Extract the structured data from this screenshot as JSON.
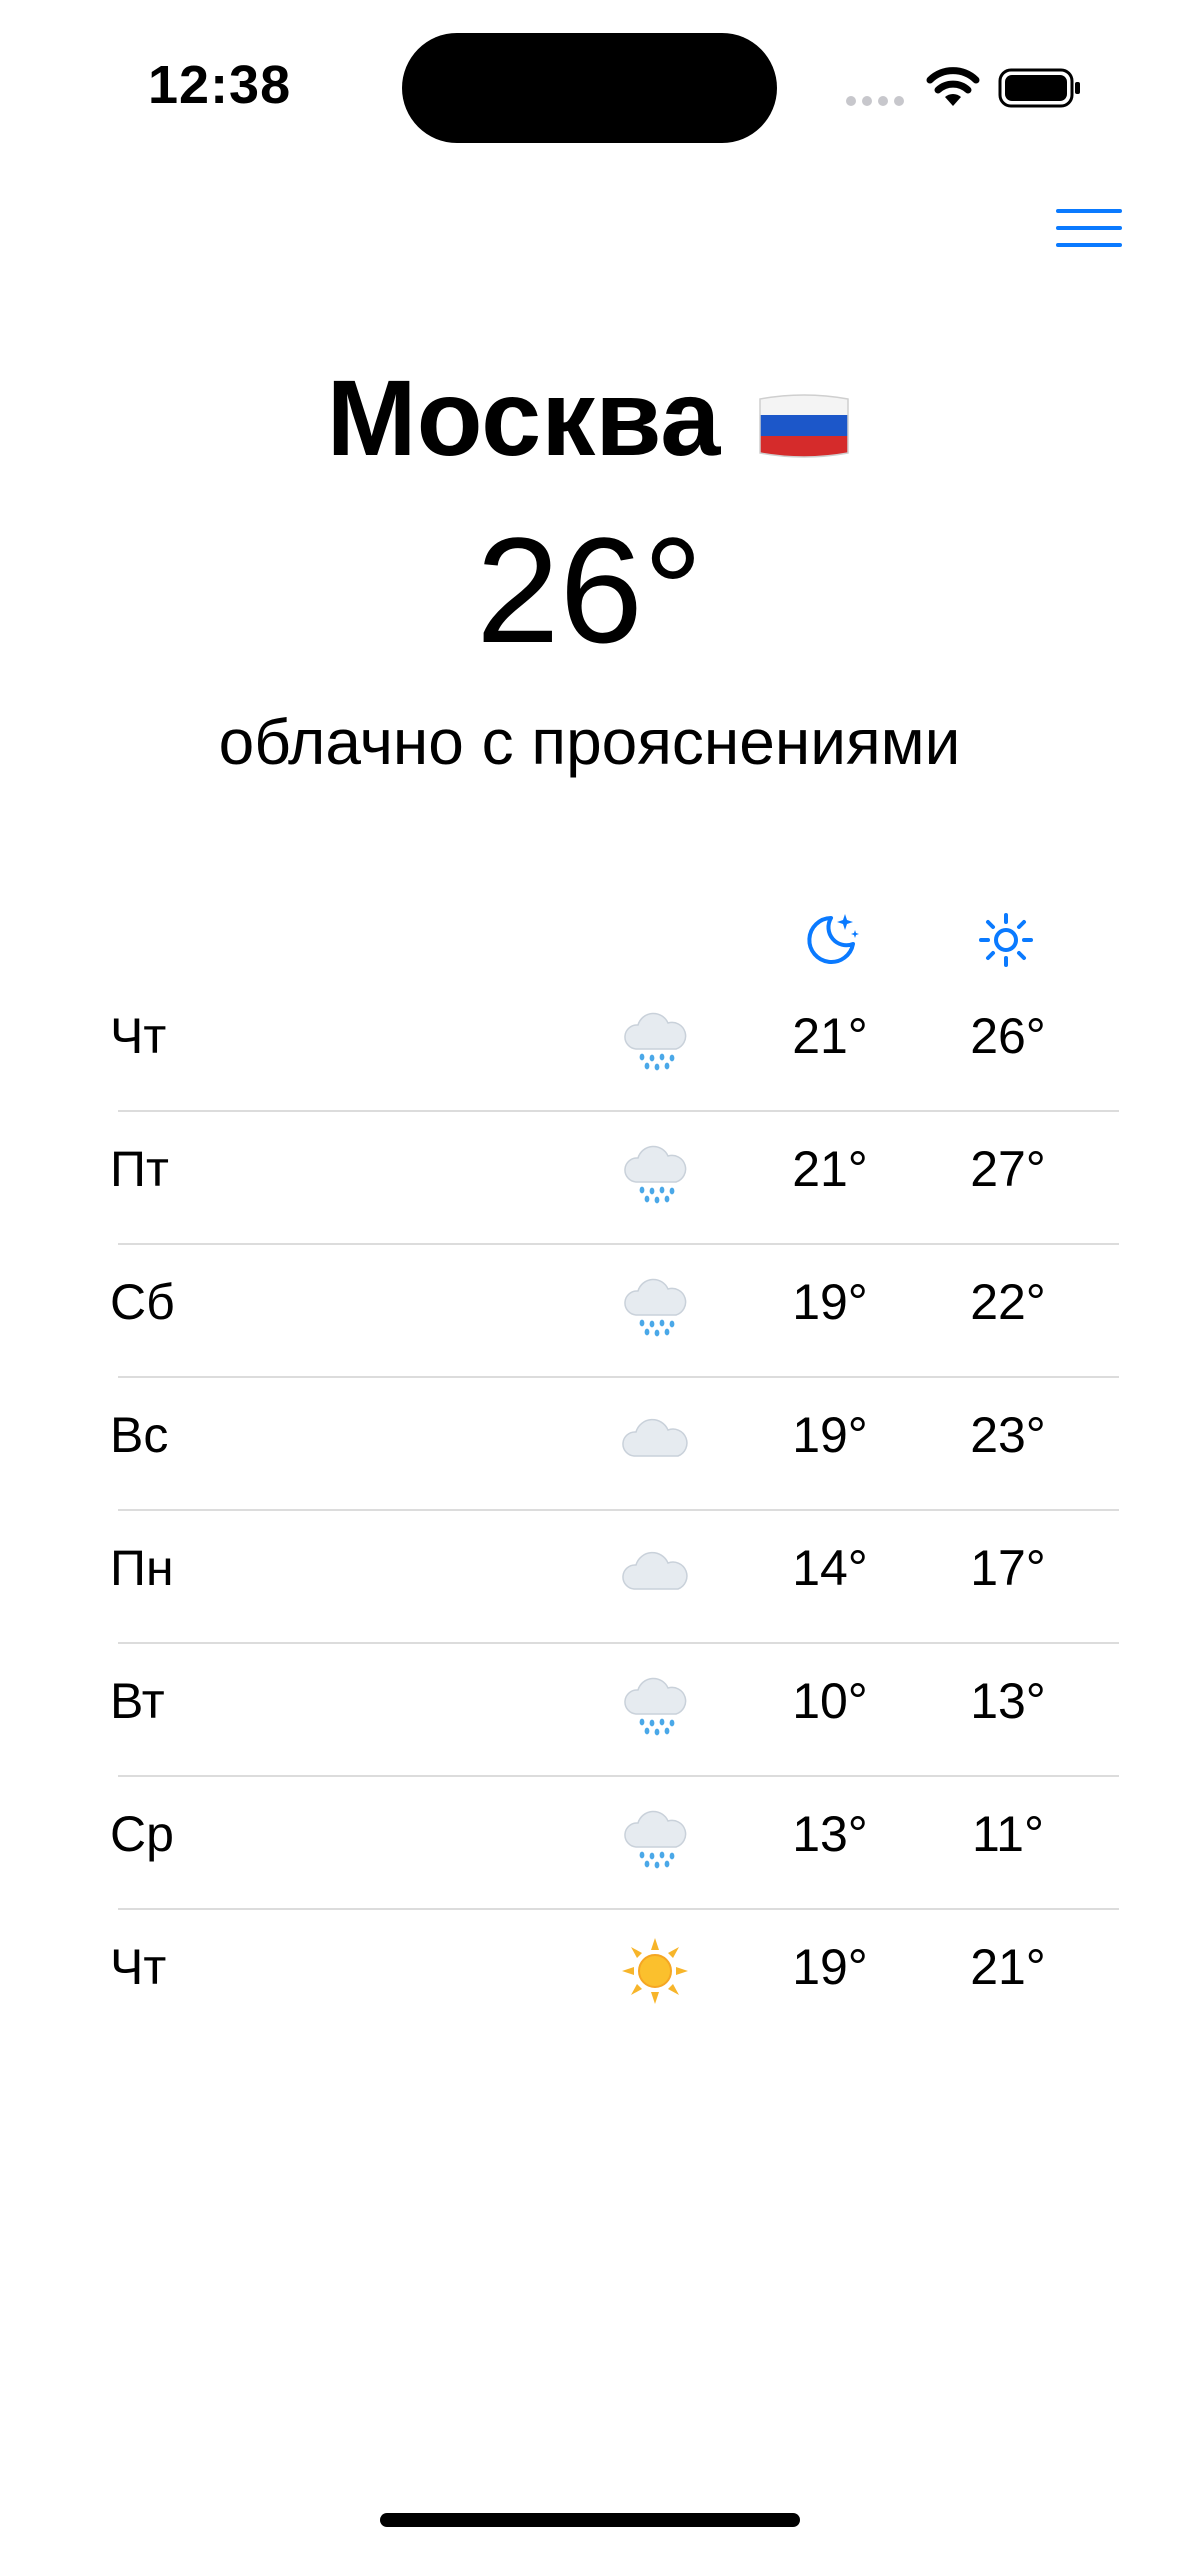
{
  "status_bar": {
    "time": "12:38"
  },
  "header": {
    "city": "Москва",
    "flag_icon": "russia-flag-icon",
    "temperature": "26°",
    "condition": "облачно с прояснениями",
    "menu_icon": "hamburger-menu-icon"
  },
  "columns": {
    "night_icon": "moon-stars-icon",
    "day_icon": "sun-icon"
  },
  "forecast": [
    {
      "day": "Чт",
      "icon": "rain-cloud-icon",
      "night": "21°",
      "high": "26°"
    },
    {
      "day": "Пт",
      "icon": "rain-cloud-icon",
      "night": "21°",
      "high": "27°"
    },
    {
      "day": "Сб",
      "icon": "rain-cloud-icon",
      "night": "19°",
      "high": "22°"
    },
    {
      "day": "Вс",
      "icon": "cloud-icon",
      "night": "19°",
      "high": "23°"
    },
    {
      "day": "Пн",
      "icon": "cloud-icon",
      "night": "14°",
      "high": "17°"
    },
    {
      "day": "Вт",
      "icon": "rain-cloud-icon",
      "night": "10°",
      "high": "13°"
    },
    {
      "day": "Ср",
      "icon": "rain-cloud-icon",
      "night": "13°",
      "high": "11°"
    },
    {
      "day": "Чт",
      "icon": "sun-icon",
      "night": "19°",
      "high": "21°"
    }
  ],
  "colors": {
    "accent": "#0a7aff",
    "separator": "#dcdcdc"
  }
}
